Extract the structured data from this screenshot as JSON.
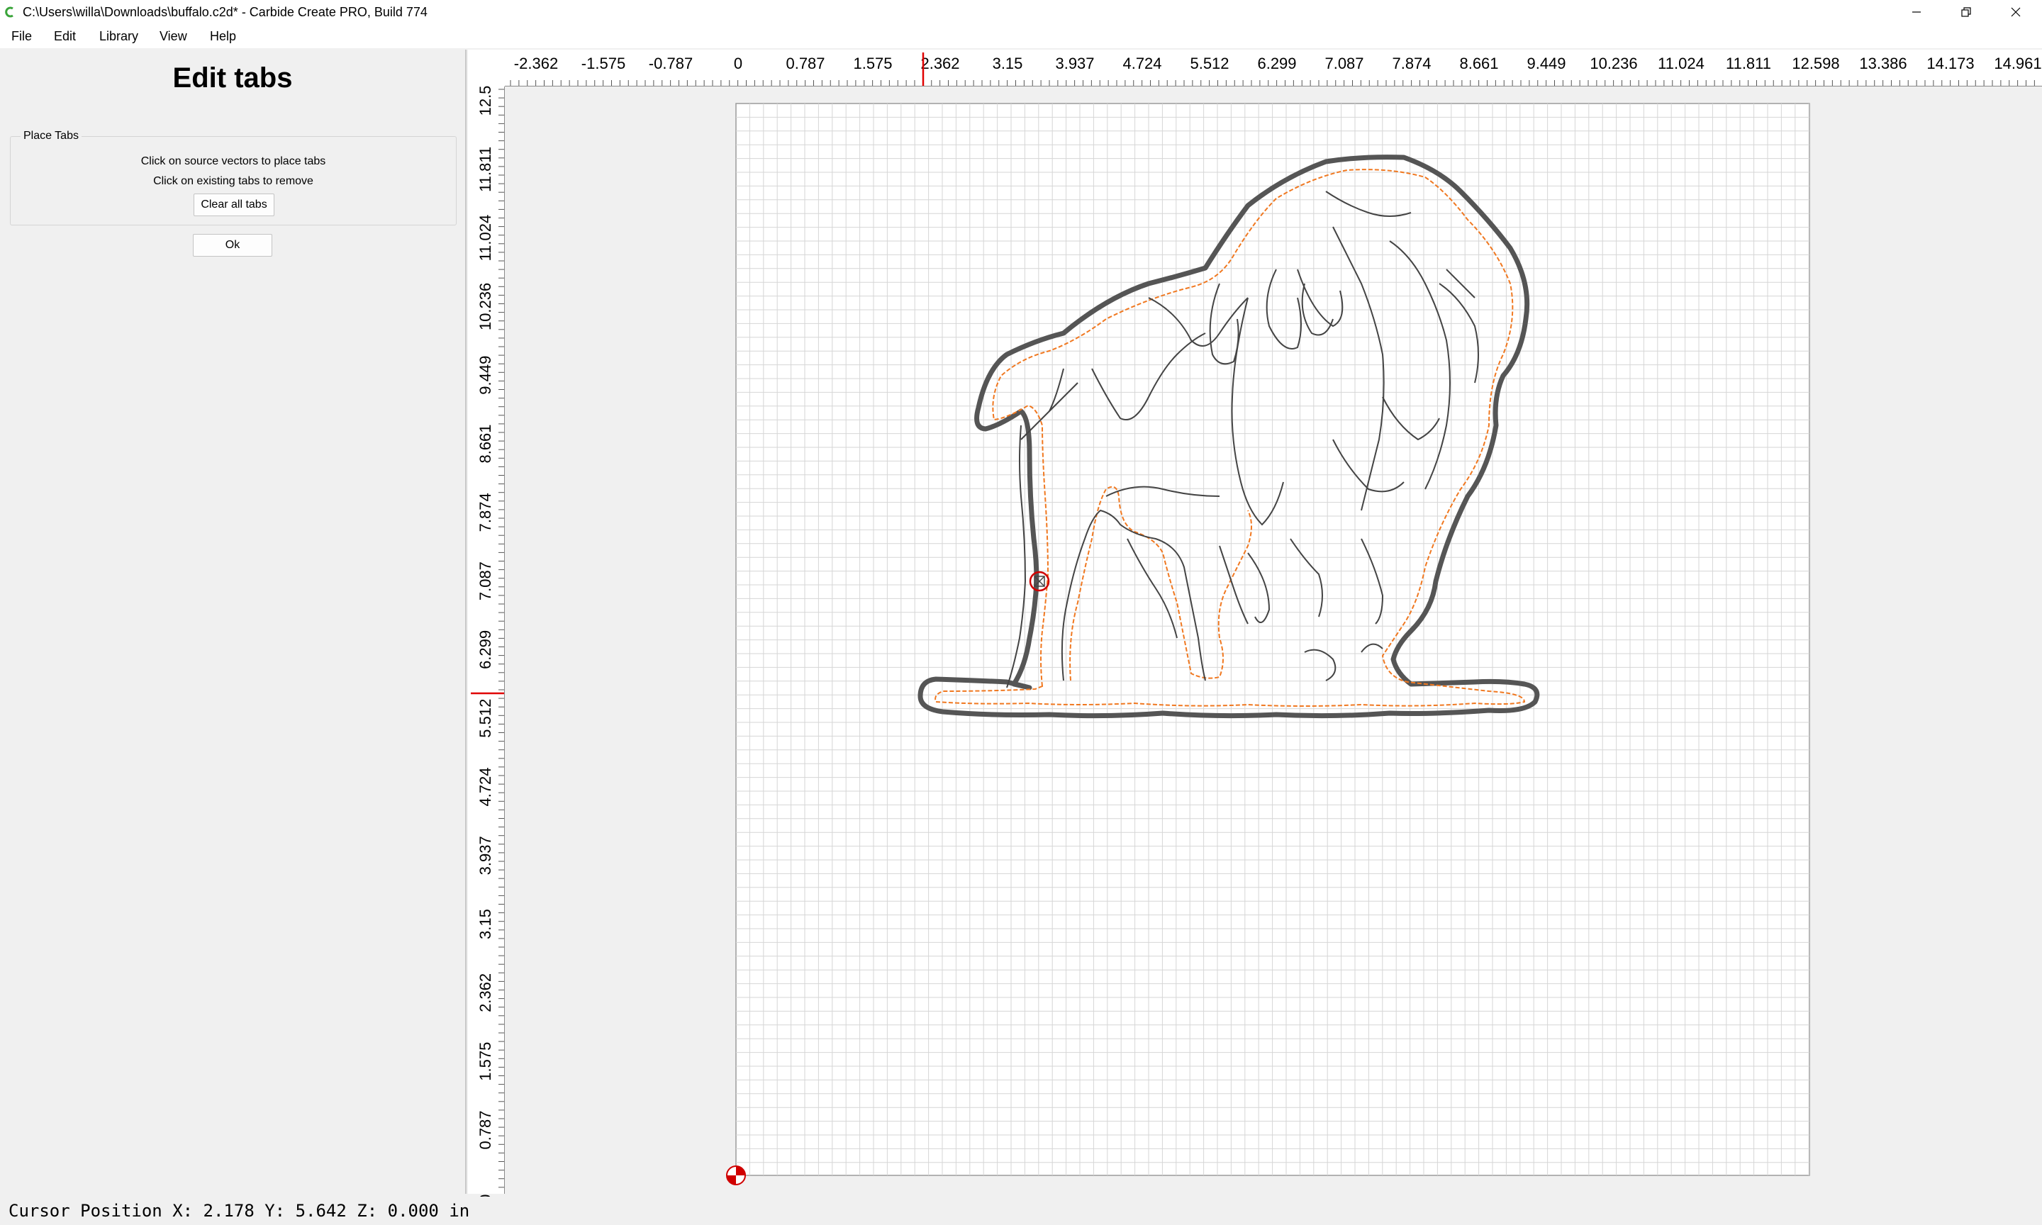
{
  "window": {
    "title": "C:\\Users\\willa\\Downloads\\buffalo.c2d* - Carbide Create PRO, Build 774"
  },
  "menu": {
    "items": [
      {
        "label": "File"
      },
      {
        "label": "Edit"
      },
      {
        "label": "Library"
      },
      {
        "label": "View"
      },
      {
        "label": "Help"
      }
    ]
  },
  "panel": {
    "title": "Edit tabs",
    "group_label": "Place Tabs",
    "instruction_1": "Click on source vectors to place tabs",
    "instruction_2": "Click on existing tabs to remove",
    "clear_button": "Clear all tabs",
    "ok_button": "Ok"
  },
  "ruler": {
    "horizontal": [
      "-2.362",
      "-1.575",
      "-0.787",
      "0",
      "0.787",
      "1.575",
      "2.362",
      "3.15",
      "3.937",
      "4.724",
      "5.512",
      "6.299",
      "7.087",
      "7.874",
      "8.661",
      "9.449",
      "10.236",
      "11.024",
      "11.811",
      "12.598",
      "13.386",
      "14.173",
      "14.961"
    ],
    "vertical": [
      "12.5",
      "11.811",
      "11.024",
      "10.236",
      "9.449",
      "8.661",
      "7.874",
      "7.087",
      "6.299",
      "5.512",
      "4.724",
      "3.937",
      "3.15",
      "2.362",
      "1.575",
      "0.787",
      "0"
    ]
  },
  "status": {
    "cursor_position": "Cursor Position X: 2.178 Y: 5.642 Z: 0.000 in"
  },
  "colors": {
    "toolpath": "#f07820",
    "vector": "#3c3c3c",
    "cursor_marker": "#e00000",
    "grid": "#d6d6d6"
  },
  "icons": [
    "app-icon",
    "minimize-icon",
    "restore-icon",
    "close-icon",
    "tab-marker-icon",
    "origin-icon"
  ]
}
